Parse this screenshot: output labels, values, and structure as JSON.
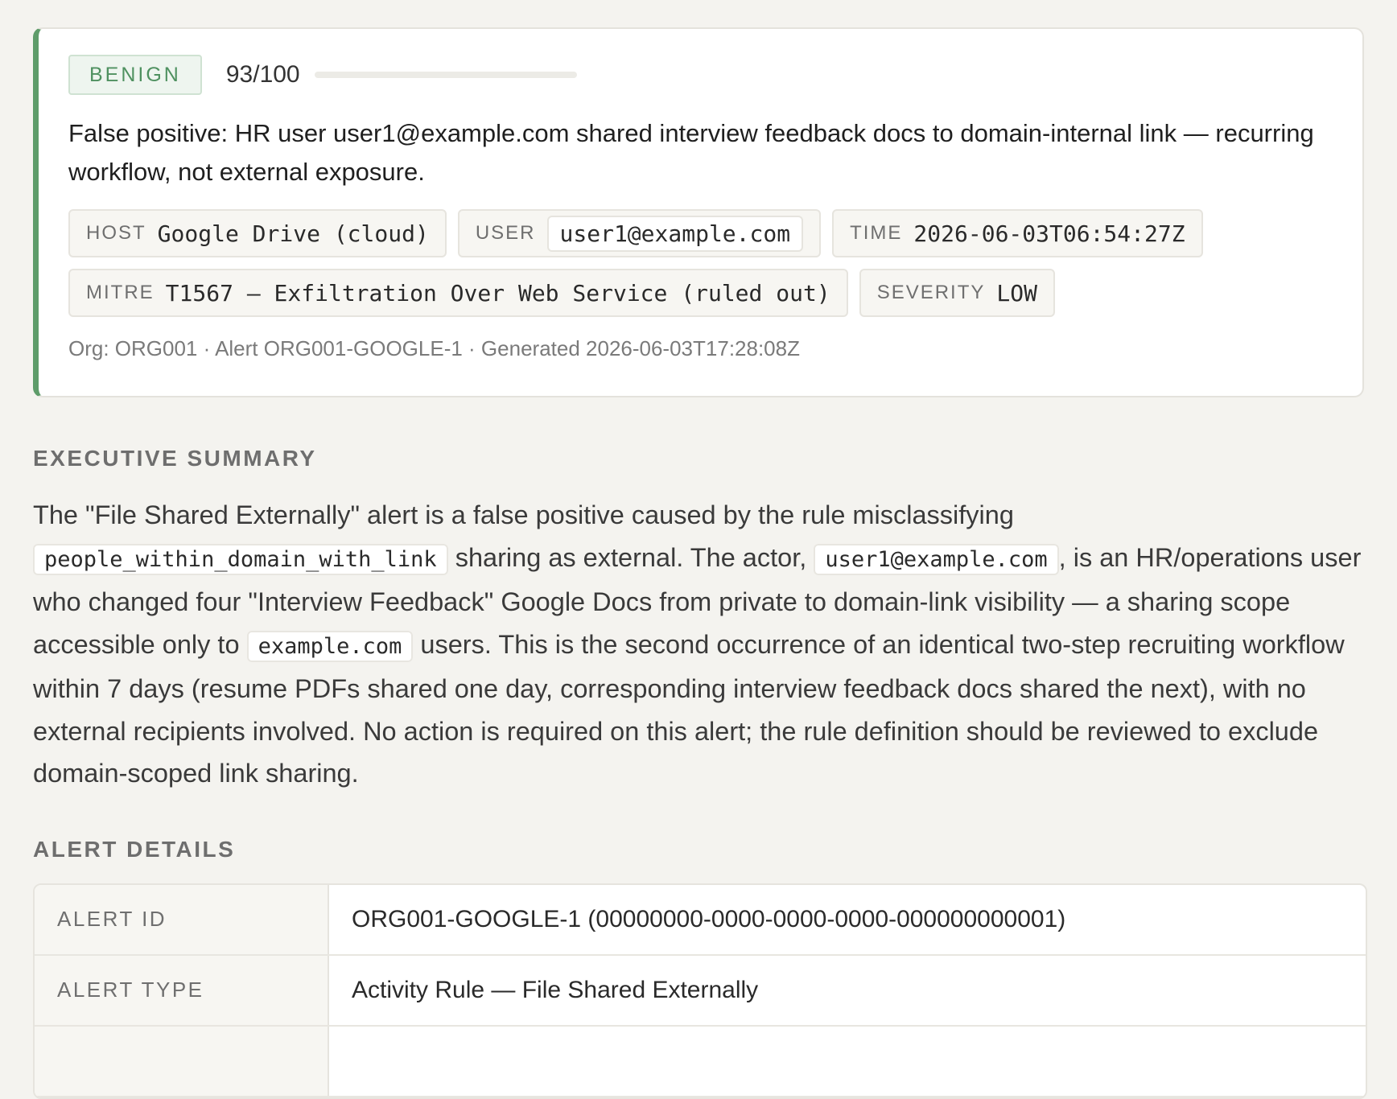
{
  "verdict": {
    "label": "BENIGN",
    "score_text": "93/100",
    "score_fraction": 0.0,
    "accent_color": "#5e9c6a",
    "summary": "False positive: HR user user1@example.com shared interview feedback docs to domain-internal link — recurring workflow, not external exposure.",
    "tags": [
      {
        "key": "HOST",
        "value": "Google Drive (cloud)"
      },
      {
        "key": "USER",
        "value": "user1@example.com"
      },
      {
        "key": "TIME",
        "value": "2026-06-03T06:54:27Z"
      },
      {
        "key": "MITRE",
        "value": "T1567 — Exfiltration Over Web Service (ruled out)"
      },
      {
        "key": "SEVERITY",
        "value": "LOW"
      }
    ],
    "meta": "Org: ORG001 · Alert ORG001-GOOGLE-1 · Generated 2026-06-03T17:28:08Z"
  },
  "executive_summary": {
    "heading": "EXECUTIVE SUMMARY",
    "parts": [
      "The \"File Shared Externally\" alert is a false positive caused by the rule misclassifying ",
      "people_within_domain_with_link",
      " sharing as external. The actor, ",
      "user1@example.com",
      ", is an HR/operations user who changed four \"Interview Feedback\" Google Docs from private to domain-link visibility — a sharing scope accessible only to ",
      "example.com",
      " users. This is the second occurrence of an identical two-step recruiting workflow within 7 days (resume PDFs shared one day, corresponding interview feedback docs shared the next), with no external recipients involved. No action is required on this alert; the rule definition should be reviewed to exclude domain-scoped link sharing."
    ]
  },
  "alert_details": {
    "heading": "ALERT DETAILS",
    "rows": [
      {
        "key": "ALERT ID",
        "value": "ORG001-GOOGLE-1 (00000000-0000-0000-0000-000000000001)"
      },
      {
        "key": "ALERT TYPE",
        "value": "Activity Rule — File Shared Externally"
      },
      {
        "key": "",
        "value": ""
      }
    ]
  }
}
